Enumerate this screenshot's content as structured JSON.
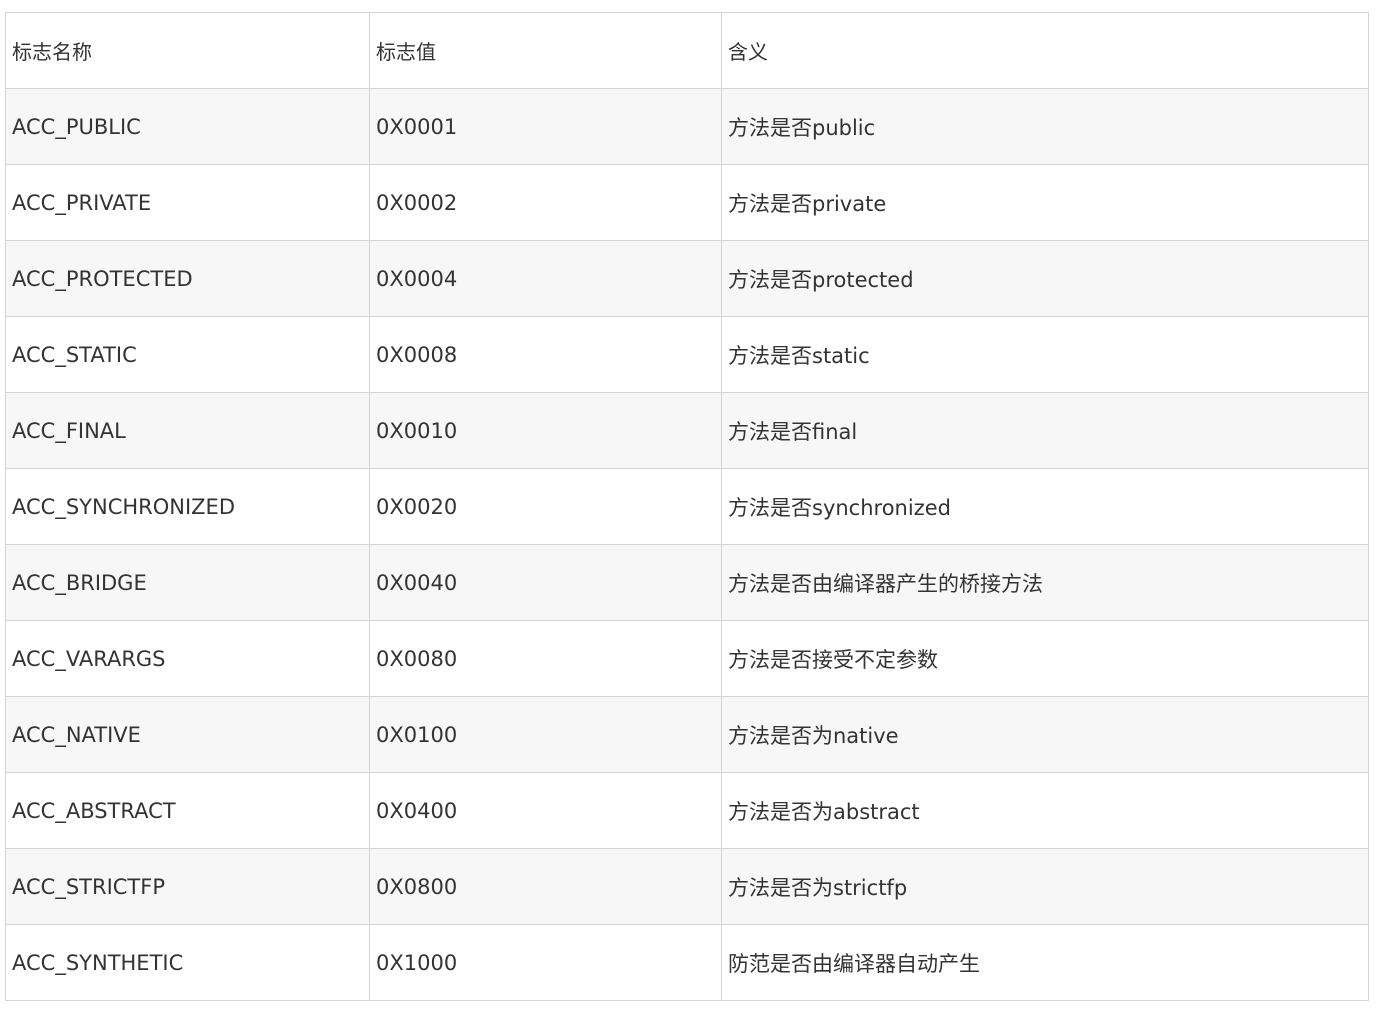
{
  "table": {
    "headers": [
      "标志名称",
      "标志值",
      "含义"
    ],
    "rows": [
      [
        "ACC_PUBLIC",
        "0X0001",
        "方法是否public"
      ],
      [
        "ACC_PRIVATE",
        "0X0002",
        "方法是否private"
      ],
      [
        "ACC_PROTECTED",
        "0X0004",
        "方法是否protected"
      ],
      [
        "ACC_STATIC",
        "0X0008",
        "方法是否static"
      ],
      [
        "ACC_FINAL",
        "0X0010",
        "方法是否final"
      ],
      [
        "ACC_SYNCHRONIZED",
        "0X0020",
        "方法是否synchronized"
      ],
      [
        "ACC_BRIDGE",
        "0X0040",
        "方法是否由编译器产生的桥接方法"
      ],
      [
        "ACC_VARARGS",
        "0X0080",
        "方法是否接受不定参数"
      ],
      [
        "ACC_NATIVE",
        "0X0100",
        "方法是否为native"
      ],
      [
        "ACC_ABSTRACT",
        "0X0400",
        "方法是否为abstract"
      ],
      [
        "ACC_STRICTFP",
        "0X0800",
        "方法是否为strictfp"
      ],
      [
        "ACC_SYNTHETIC",
        "0X1000",
        "防范是否由编译器自动产生"
      ]
    ]
  },
  "colors": {
    "border": "#d4d4d4",
    "row_alt": "#f7f7f7",
    "row_plain": "#ffffff",
    "text": "#333333"
  }
}
